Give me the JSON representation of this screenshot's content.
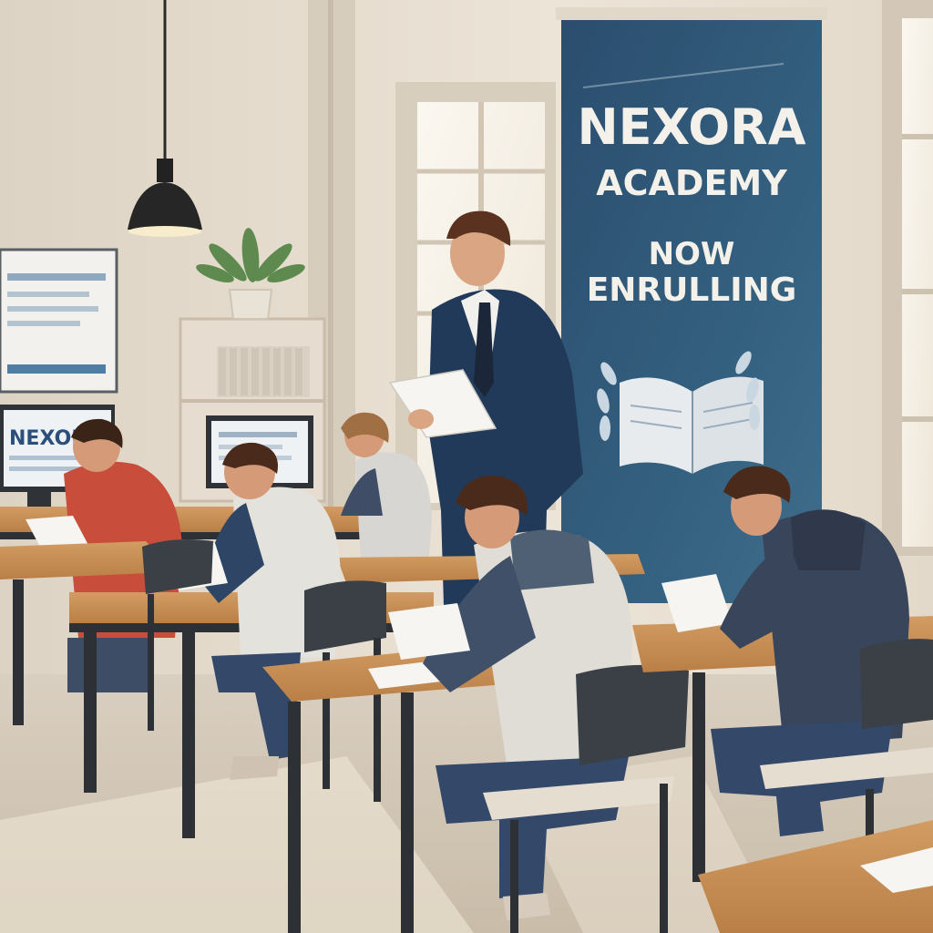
{
  "banner": {
    "title": "NEXORA",
    "subtitle": "ACADEMY",
    "line1": "NOW",
    "line2": "ENRULLING"
  },
  "monitor": {
    "text": "NEXORA"
  },
  "colors": {
    "wall": "#e9e1d4",
    "banner": "#2f5678",
    "desk": "#c8935a",
    "floor": "#d8cdbd"
  }
}
